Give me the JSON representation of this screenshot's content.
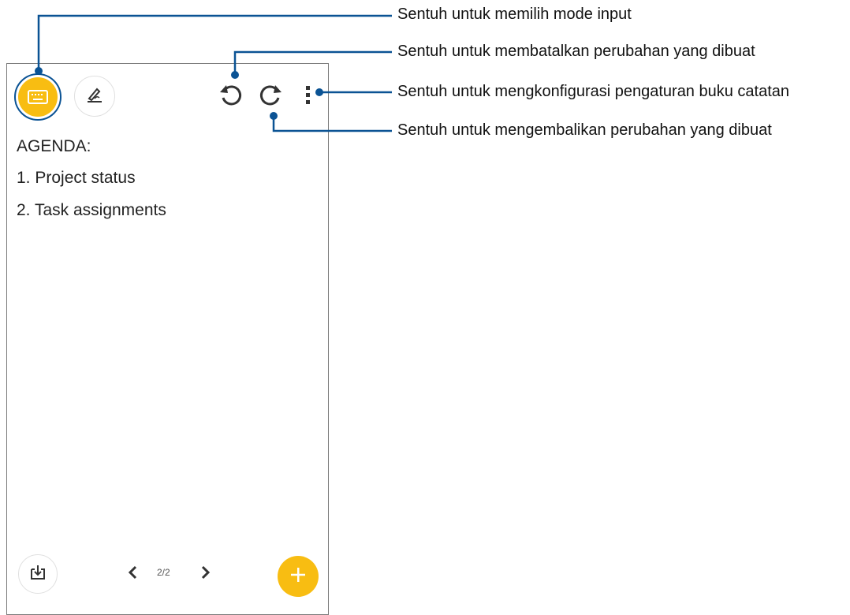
{
  "note": {
    "lines": [
      "AGENDA:",
      "1. Project status",
      "2. Task assignments"
    ]
  },
  "toolbar": {
    "keyboard_icon": "keyboard-icon",
    "handwrite_icon": "pen-handwriting-icon",
    "undo_icon": "undo-icon",
    "redo_icon": "redo-icon",
    "menu_icon": "more-vertical-icon"
  },
  "footer": {
    "page_indicator": "2/2",
    "import_icon": "import-icon",
    "add_icon": "plus-icon"
  },
  "callouts": {
    "input_mode": "Sentuh untuk memilih mode input",
    "undo": "Sentuh untuk membatalkan perubahan yang dibuat",
    "settings": "Sentuh untuk mengkonfigurasi pengaturan buku catatan",
    "redo": "Sentuh untuk mengembalikan perubahan yang dibuat"
  },
  "colors": {
    "accent": "#f8bd12",
    "callout_line": "#0b5394"
  }
}
